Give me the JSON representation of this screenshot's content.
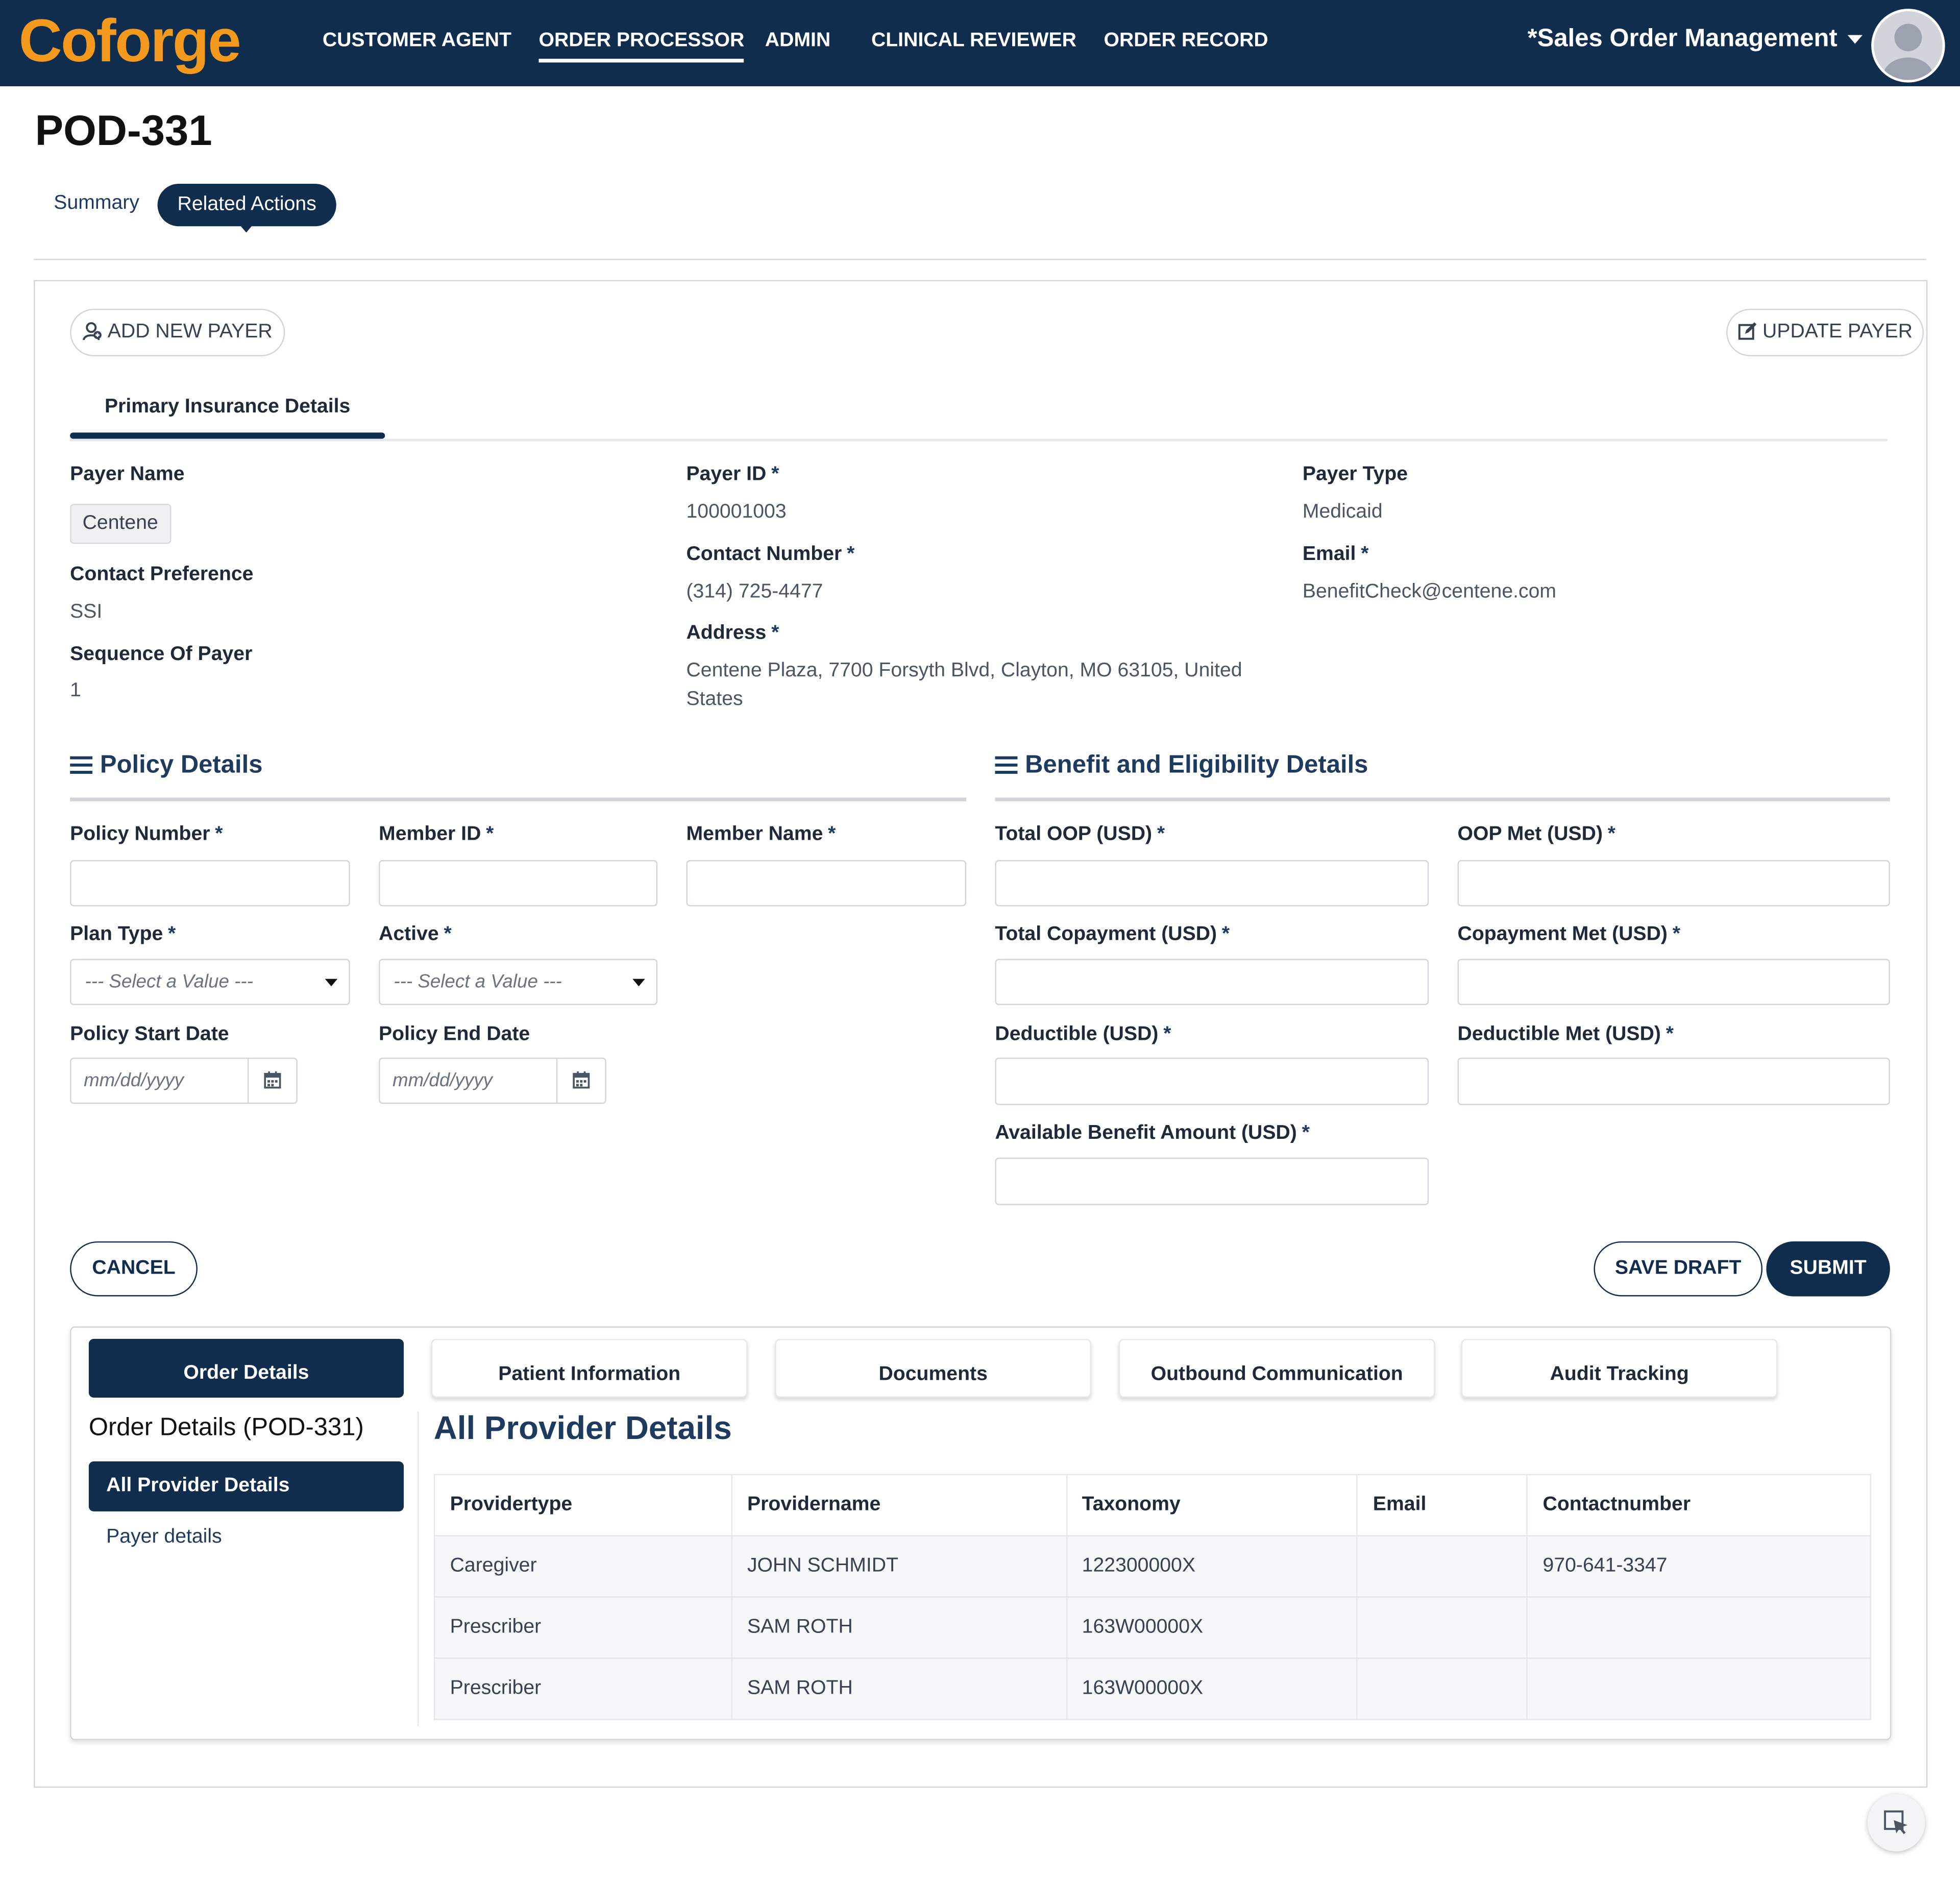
{
  "header": {
    "logo_text": "Coforge",
    "nav": [
      {
        "label": "CUSTOMER AGENT"
      },
      {
        "label": "ORDER PROCESSOR",
        "active": true
      },
      {
        "label": "ADMIN"
      },
      {
        "label": "CLINICAL REVIEWER"
      },
      {
        "label": "ORDER RECORD"
      }
    ],
    "app_menu_label": "*Sales Order Management"
  },
  "page": {
    "title": "POD-331",
    "tabs": [
      {
        "label": "Summary"
      },
      {
        "label": "Related Actions",
        "active": true
      }
    ]
  },
  "payer_actions": {
    "add_label": "ADD NEW PAYER",
    "update_label": "UPDATE PAYER"
  },
  "section_tab": "Primary Insurance Details",
  "payer": {
    "payer_name_label": "Payer Name",
    "payer_name": "Centene",
    "contact_pref_label": "Contact Preference",
    "contact_pref": "SSI",
    "sequence_label": "Sequence Of Payer",
    "sequence": "1",
    "payer_id_label": "Payer ID",
    "payer_id": "100001003",
    "contact_number_label": "Contact Number",
    "contact_number": "(314) 725-4477",
    "address_label": "Address",
    "address_line1": "Centene Plaza, 7700 Forsyth Blvd, Clayton, MO 63105, United",
    "address_line2": "States",
    "payer_type_label": "Payer Type",
    "payer_type": "Medicaid",
    "email_label": "Email",
    "email": "BenefitCheck@centene.com",
    "required_mark": "*"
  },
  "policy": {
    "heading": "Policy Details",
    "policy_number_label": "Policy Number",
    "member_id_label": "Member ID",
    "member_name_label": "Member Name",
    "plan_type_label": "Plan Type",
    "active_label": "Active",
    "select_placeholder": "--- Select a Value ---",
    "start_date_label": "Policy Start Date",
    "end_date_label": "Policy End Date",
    "date_placeholder": "mm/dd/yyyy"
  },
  "benefit": {
    "heading": "Benefit and Eligibility Details",
    "total_oop_label": "Total OOP (USD)",
    "oop_met_label": "OOP Met (USD)",
    "total_copay_label": "Total Copayment (USD)",
    "copay_met_label": "Copayment Met (USD)",
    "deductible_label": "Deductible (USD)",
    "deductible_met_label": "Deductible Met (USD)",
    "available_label": "Available Benefit Amount (USD)"
  },
  "form_actions": {
    "cancel": "CANCEL",
    "save_draft": "SAVE DRAFT",
    "submit": "SUBMIT"
  },
  "lower_tabs": [
    {
      "label": "Order Details",
      "active": true
    },
    {
      "label": "Patient Information"
    },
    {
      "label": "Documents"
    },
    {
      "label": "Outbound Communication"
    },
    {
      "label": "Audit Tracking"
    }
  ],
  "order_details": {
    "title": "Order Details (POD-331)",
    "side_active": "All Provider Details",
    "side_link": "Payer details",
    "table_title": "All Provider Details",
    "columns": [
      "Providertype",
      "Providername",
      "Taxonomy",
      "Email",
      "Contactnumber"
    ],
    "rows": [
      [
        "Caregiver",
        "JOHN SCHMIDT",
        "122300000X",
        "",
        "970-641-3347"
      ],
      [
        "Prescriber",
        "SAM ROTH",
        "163W00000X",
        "",
        ""
      ],
      [
        "Prescriber",
        "SAM ROTH",
        "163W00000X",
        "",
        ""
      ]
    ]
  },
  "colors": {
    "primary": "#112d4e",
    "accent_logo": "#f39a1e"
  }
}
